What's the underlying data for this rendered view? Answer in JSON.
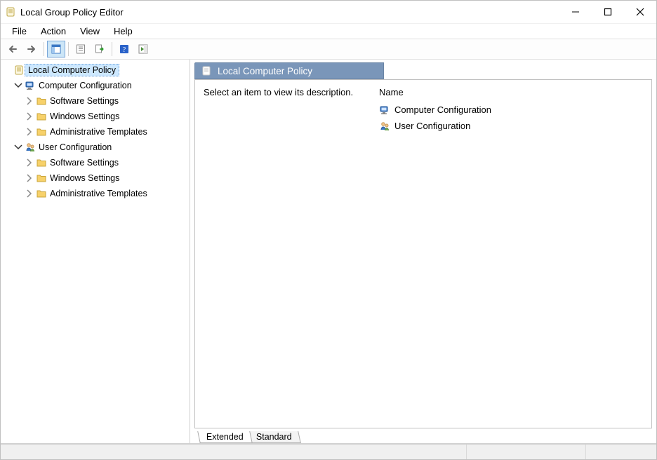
{
  "window": {
    "title": "Local Group Policy Editor"
  },
  "menubar": {
    "items": [
      "File",
      "Action",
      "View",
      "Help"
    ]
  },
  "toolbar": {
    "back": "Back",
    "forward": "Forward",
    "pane": "Show/Hide Console Tree",
    "props": "Properties",
    "export": "Export List",
    "help": "Help",
    "action": "Show/Hide Action Pane"
  },
  "tree": {
    "root": {
      "label": "Local Computer Policy"
    },
    "nodes": [
      {
        "label": "Computer Configuration",
        "expanded": true,
        "children": [
          {
            "label": "Software Settings"
          },
          {
            "label": "Windows Settings"
          },
          {
            "label": "Administrative Templates"
          }
        ]
      },
      {
        "label": "User Configuration",
        "expanded": true,
        "children": [
          {
            "label": "Software Settings"
          },
          {
            "label": "Windows Settings"
          },
          {
            "label": "Administrative Templates"
          }
        ]
      }
    ]
  },
  "detail": {
    "heading": "Local Computer Policy",
    "description_prompt": "Select an item to view its description.",
    "column_header": "Name",
    "items": [
      {
        "label": "Computer Configuration"
      },
      {
        "label": "User Configuration"
      }
    ],
    "tabs": {
      "extended": "Extended",
      "standard": "Standard"
    }
  }
}
